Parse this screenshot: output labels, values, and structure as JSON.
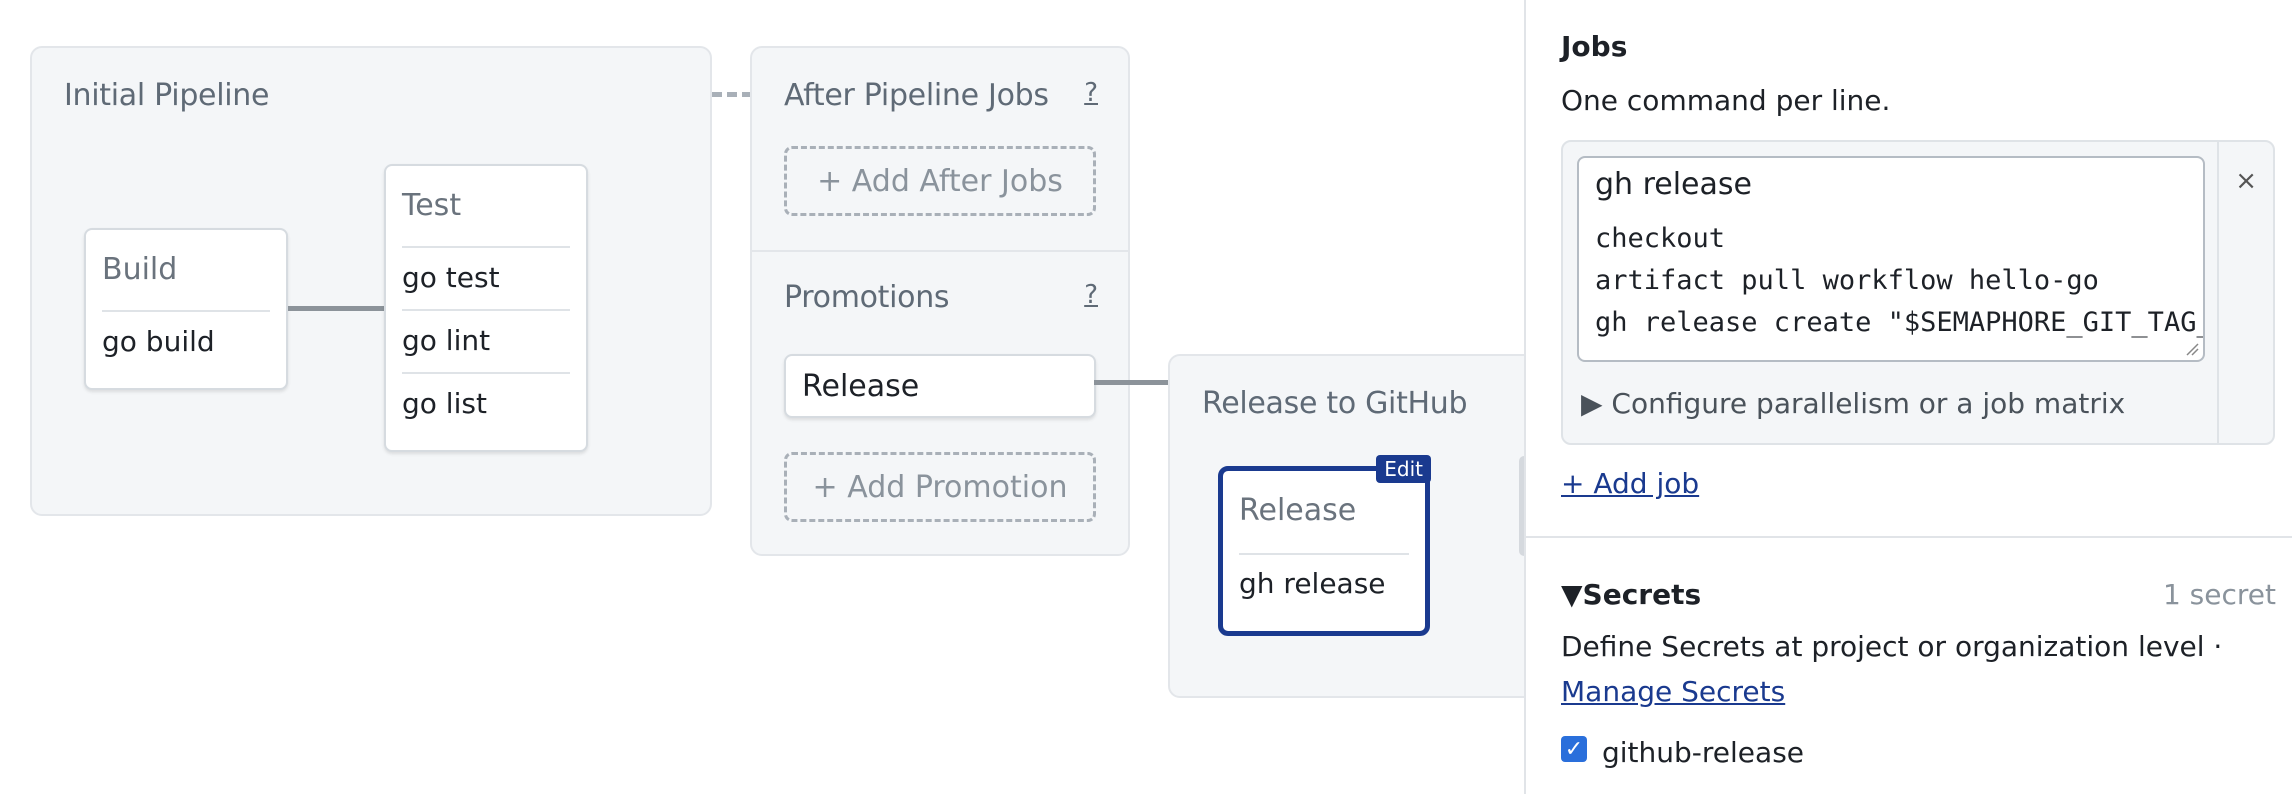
{
  "canvas": {
    "initial": {
      "title": "Initial Pipeline",
      "build": {
        "title": "Build",
        "commands": [
          "go build"
        ]
      },
      "test": {
        "title": "Test",
        "commands": [
          "go test",
          "go lint",
          "go list"
        ]
      }
    },
    "after": {
      "title": "After Pipeline Jobs",
      "help": "?",
      "add_label": "+ Add After Jobs"
    },
    "promotions": {
      "title": "Promotions",
      "help": "?",
      "item": "Release",
      "add_label": "+ Add Promotion"
    },
    "release_block": {
      "title": "Release to GitHub",
      "job": {
        "title": "Release",
        "command": "gh release",
        "badge": "Edit"
      }
    }
  },
  "panel": {
    "jobs_heading": "Jobs",
    "jobs_hint": "One command per line.",
    "job_name": "gh release",
    "commands": [
      "checkout",
      "artifact pull workflow hello-go",
      "gh release create \"$SEMAPHORE_GIT_TAG_NAME\""
    ],
    "close_symbol": "×",
    "configure": "▶ Configure parallelism or a job matrix",
    "add_job": "+ Add job",
    "secrets_heading": "▼Secrets",
    "secrets_count": "1 secret",
    "secrets_hint": "Define Secrets at project or organization level ·",
    "manage_secrets": "Manage Secrets",
    "secret_name": "github-release"
  },
  "colors": {
    "accent": "#1a3a8f",
    "checkbox": "#2a6fdb"
  }
}
